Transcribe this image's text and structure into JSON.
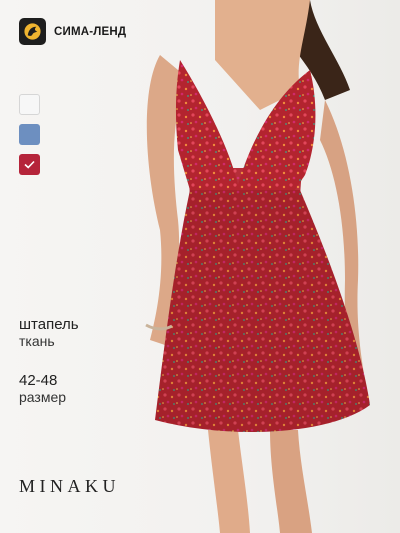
{
  "brand": {
    "name": "СИМА-ЛЕНД",
    "logo_icon": "wolf-head-icon"
  },
  "swatches": [
    {
      "name": "white",
      "color": "#f7f7f7",
      "selected": false
    },
    {
      "name": "blue",
      "color": "#6d8fc0",
      "selected": false
    },
    {
      "name": "red",
      "color": "#b5243a",
      "selected": true
    }
  ],
  "specs": [
    {
      "value": "штапель",
      "label": "ткань"
    },
    {
      "value": "42-48",
      "label": "размер"
    }
  ],
  "footer_logo": "MINAKU"
}
